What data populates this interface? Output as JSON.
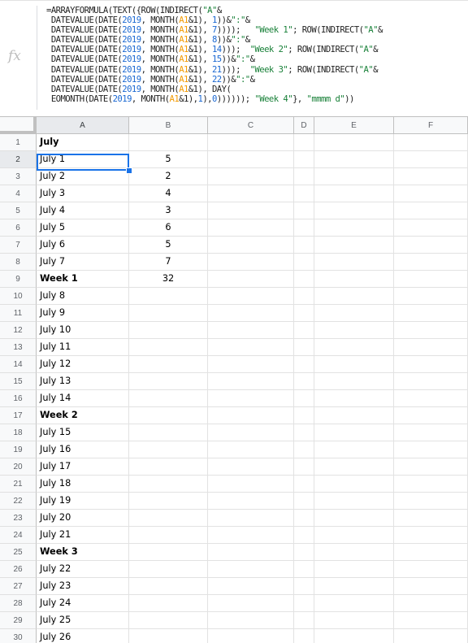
{
  "formula_bar": {
    "icon": "fx-icon",
    "icon_text": "fx",
    "lines": [
      [
        {
          "t": "=ARRAYFORMULA(TEXT({ROW(INDIRECT(",
          "c": ""
        },
        {
          "t": "\"A\"",
          "c": "str"
        },
        {
          "t": "&",
          "c": ""
        }
      ],
      [
        {
          "t": " DATEVALUE(DATE(",
          "c": ""
        },
        {
          "t": "2019",
          "c": "num"
        },
        {
          "t": ", MONTH(",
          "c": ""
        },
        {
          "t": "A1",
          "c": "ref"
        },
        {
          "t": "&1), ",
          "c": ""
        },
        {
          "t": "1",
          "c": "num"
        },
        {
          "t": "))&",
          "c": ""
        },
        {
          "t": "\":\"",
          "c": "str"
        },
        {
          "t": "&",
          "c": ""
        }
      ],
      [
        {
          "t": " DATEVALUE(DATE(",
          "c": ""
        },
        {
          "t": "2019",
          "c": "num"
        },
        {
          "t": ", MONTH(",
          "c": ""
        },
        {
          "t": "A1",
          "c": "ref"
        },
        {
          "t": "&1), ",
          "c": ""
        },
        {
          "t": "7",
          "c": "num"
        },
        {
          "t": "))));   ",
          "c": ""
        },
        {
          "t": "\"Week 1\"",
          "c": "str"
        },
        {
          "t": "; ROW(INDIRECT(",
          "c": ""
        },
        {
          "t": "\"A\"",
          "c": "str"
        },
        {
          "t": "&",
          "c": ""
        }
      ],
      [
        {
          "t": " DATEVALUE(DATE(",
          "c": ""
        },
        {
          "t": "2019",
          "c": "num"
        },
        {
          "t": ", MONTH(",
          "c": ""
        },
        {
          "t": "A1",
          "c": "ref"
        },
        {
          "t": "&1), ",
          "c": ""
        },
        {
          "t": "8",
          "c": "num"
        },
        {
          "t": "))&",
          "c": ""
        },
        {
          "t": "\":\"",
          "c": "str"
        },
        {
          "t": "&",
          "c": ""
        }
      ],
      [
        {
          "t": " DATEVALUE(DATE(",
          "c": ""
        },
        {
          "t": "2019",
          "c": "num"
        },
        {
          "t": ", MONTH(",
          "c": ""
        },
        {
          "t": "A1",
          "c": "ref"
        },
        {
          "t": "&1), ",
          "c": ""
        },
        {
          "t": "14",
          "c": "num"
        },
        {
          "t": ")));  ",
          "c": ""
        },
        {
          "t": "\"Week 2\"",
          "c": "str"
        },
        {
          "t": "; ROW(INDIRECT(",
          "c": ""
        },
        {
          "t": "\"A\"",
          "c": "str"
        },
        {
          "t": "&",
          "c": ""
        }
      ],
      [
        {
          "t": " DATEVALUE(DATE(",
          "c": ""
        },
        {
          "t": "2019",
          "c": "num"
        },
        {
          "t": ", MONTH(",
          "c": ""
        },
        {
          "t": "A1",
          "c": "ref"
        },
        {
          "t": "&1), ",
          "c": ""
        },
        {
          "t": "15",
          "c": "num"
        },
        {
          "t": "))&",
          "c": ""
        },
        {
          "t": "\":\"",
          "c": "str"
        },
        {
          "t": "&",
          "c": ""
        }
      ],
      [
        {
          "t": " DATEVALUE(DATE(",
          "c": ""
        },
        {
          "t": "2019",
          "c": "num"
        },
        {
          "t": ", MONTH(",
          "c": ""
        },
        {
          "t": "A1",
          "c": "ref"
        },
        {
          "t": "&1), ",
          "c": ""
        },
        {
          "t": "21",
          "c": "num"
        },
        {
          "t": ")));  ",
          "c": ""
        },
        {
          "t": "\"Week 3\"",
          "c": "str"
        },
        {
          "t": "; ROW(INDIRECT(",
          "c": ""
        },
        {
          "t": "\"A\"",
          "c": "str"
        },
        {
          "t": "&",
          "c": ""
        }
      ],
      [
        {
          "t": " DATEVALUE(DATE(",
          "c": ""
        },
        {
          "t": "2019",
          "c": "num"
        },
        {
          "t": ", MONTH(",
          "c": ""
        },
        {
          "t": "A1",
          "c": "ref"
        },
        {
          "t": "&1), ",
          "c": ""
        },
        {
          "t": "22",
          "c": "num"
        },
        {
          "t": "))&",
          "c": ""
        },
        {
          "t": "\":\"",
          "c": "str"
        },
        {
          "t": "&",
          "c": ""
        }
      ],
      [
        {
          "t": " DATEVALUE(DATE(",
          "c": ""
        },
        {
          "t": "2019",
          "c": "num"
        },
        {
          "t": ", MONTH(",
          "c": ""
        },
        {
          "t": "A1",
          "c": "ref"
        },
        {
          "t": "&1), DAY(",
          "c": ""
        }
      ],
      [
        {
          "t": " EOMONTH(DATE(",
          "c": ""
        },
        {
          "t": "2019",
          "c": "num"
        },
        {
          "t": ", MONTH(",
          "c": ""
        },
        {
          "t": "A1",
          "c": "ref"
        },
        {
          "t": "&1),",
          "c": ""
        },
        {
          "t": "1",
          "c": "num"
        },
        {
          "t": "),",
          "c": ""
        },
        {
          "t": "0",
          "c": "num"
        },
        {
          "t": ")))))); ",
          "c": ""
        },
        {
          "t": "\"Week 4\"",
          "c": "str"
        },
        {
          "t": "}, ",
          "c": ""
        },
        {
          "t": "\"mmmm d\"",
          "c": "str"
        },
        {
          "t": "))",
          "c": ""
        }
      ]
    ]
  },
  "columns": [
    "A",
    "B",
    "C",
    "D",
    "E",
    "F"
  ],
  "selected_cell": "A2",
  "rows": [
    {
      "n": "1",
      "a": "July",
      "b": "",
      "bold": true
    },
    {
      "n": "2",
      "a": "July 1",
      "b": "5",
      "bold": false
    },
    {
      "n": "3",
      "a": "July 2",
      "b": "2",
      "bold": false
    },
    {
      "n": "4",
      "a": "July 3",
      "b": "4",
      "bold": false
    },
    {
      "n": "5",
      "a": "July 4",
      "b": "3",
      "bold": false
    },
    {
      "n": "6",
      "a": "July 5",
      "b": "6",
      "bold": false
    },
    {
      "n": "7",
      "a": "July 6",
      "b": "5",
      "bold": false
    },
    {
      "n": "8",
      "a": "July 7",
      "b": "7",
      "bold": false
    },
    {
      "n": "9",
      "a": "Week 1",
      "b": "32",
      "bold": true
    },
    {
      "n": "10",
      "a": "July 8",
      "b": "",
      "bold": false
    },
    {
      "n": "11",
      "a": "July 9",
      "b": "",
      "bold": false
    },
    {
      "n": "12",
      "a": "July 10",
      "b": "",
      "bold": false
    },
    {
      "n": "13",
      "a": "July 11",
      "b": "",
      "bold": false
    },
    {
      "n": "14",
      "a": "July 12",
      "b": "",
      "bold": false
    },
    {
      "n": "15",
      "a": "July 13",
      "b": "",
      "bold": false
    },
    {
      "n": "16",
      "a": "July 14",
      "b": "",
      "bold": false
    },
    {
      "n": "17",
      "a": "Week 2",
      "b": "",
      "bold": true
    },
    {
      "n": "18",
      "a": "July 15",
      "b": "",
      "bold": false
    },
    {
      "n": "19",
      "a": "July 16",
      "b": "",
      "bold": false
    },
    {
      "n": "20",
      "a": "July 17",
      "b": "",
      "bold": false
    },
    {
      "n": "21",
      "a": "July 18",
      "b": "",
      "bold": false
    },
    {
      "n": "22",
      "a": "July 19",
      "b": "",
      "bold": false
    },
    {
      "n": "23",
      "a": "July 20",
      "b": "",
      "bold": false
    },
    {
      "n": "24",
      "a": "July 21",
      "b": "",
      "bold": false
    },
    {
      "n": "25",
      "a": "Week 3",
      "b": "",
      "bold": true
    },
    {
      "n": "26",
      "a": "July 22",
      "b": "",
      "bold": false
    },
    {
      "n": "27",
      "a": "July 23",
      "b": "",
      "bold": false
    },
    {
      "n": "28",
      "a": "July 24",
      "b": "",
      "bold": false
    },
    {
      "n": "29",
      "a": "July 25",
      "b": "",
      "bold": false
    },
    {
      "n": "30",
      "a": "July 26",
      "b": "",
      "bold": false
    }
  ]
}
